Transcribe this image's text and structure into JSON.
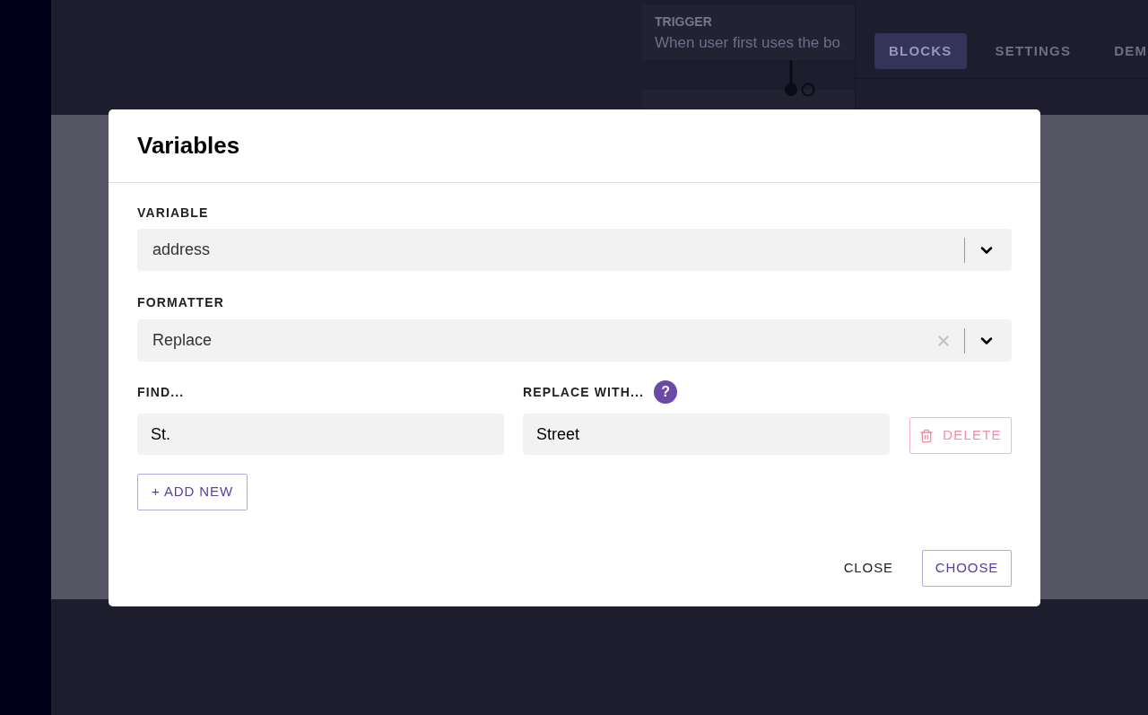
{
  "background": {
    "trigger_card": {
      "title": "TRIGGER",
      "text": "When user first uses the bo"
    },
    "tabs": [
      {
        "label": "BLOCKS",
        "selected": true
      },
      {
        "label": "SETTINGS",
        "selected": false
      },
      {
        "label": "DEM",
        "selected": false
      }
    ]
  },
  "dialog": {
    "title": "Variables",
    "variable": {
      "label": "VARIABLE",
      "value": "address",
      "clearable": false
    },
    "formatter": {
      "label": "FORMATTER",
      "value": "Replace",
      "clearable": true
    },
    "replacements": [
      {
        "find_label": "FIND...",
        "find_value": "St.",
        "replace_label": "REPLACE WITH...",
        "replace_value": "Street",
        "delete_label": "DELETE",
        "help_label": "?"
      }
    ],
    "add_button": "+ ADD NEW",
    "close_button": "CLOSE",
    "choose_button": "CHOOSE"
  }
}
